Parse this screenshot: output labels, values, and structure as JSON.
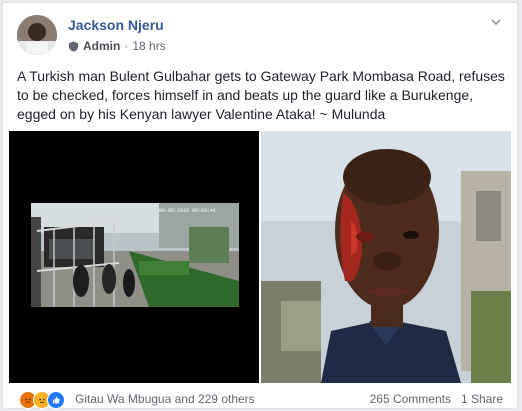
{
  "post": {
    "author": "Jackson Njeru",
    "role": "Admin",
    "time": "18 hrs",
    "text": "A Turkish man Bulent Gulbahar gets to Gateway Park Mombasa Road, refuses to be checked, forces himself in and beats up the guard like a Burukenge, egged on by his Kenyan lawyer Valentine Ataka! ~ Mulunda"
  },
  "footer": {
    "reactors": "Gitau Wa Mbugua and 229 others",
    "comments": "265 Comments",
    "shares": "1 Share"
  },
  "cctv": {
    "timestamp": "06-05-2019  08:03:41"
  },
  "colors": {
    "link": "#385898",
    "angry": "#e9710f",
    "sad": "#f7b125",
    "like": "#2078f4"
  }
}
